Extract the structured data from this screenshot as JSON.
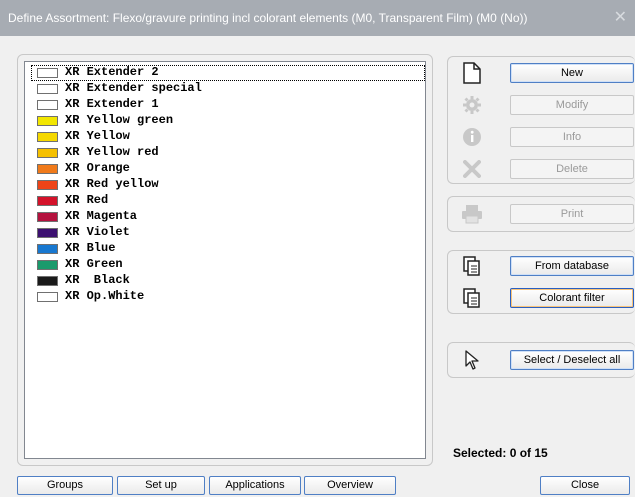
{
  "window": {
    "title": "Define Assortment: Flexo/gravure printing incl colorant elements (M0, Transparent Film) (M0 (No))",
    "close_glyph": "✕"
  },
  "colorant_list": [
    {
      "label": "XR Extender 2",
      "color": "#ffffff"
    },
    {
      "label": "XR Extender special",
      "color": "#ffffff"
    },
    {
      "label": "XR Extender 1",
      "color": "#ffffff"
    },
    {
      "label": "XR Yellow green",
      "color": "#f2e600"
    },
    {
      "label": "XR Yellow",
      "color": "#f5d800"
    },
    {
      "label": "XR Yellow red",
      "color": "#f5c000"
    },
    {
      "label": "XR Orange",
      "color": "#f07a1a"
    },
    {
      "label": "XR Red yellow",
      "color": "#ee4418"
    },
    {
      "label": "XR Red",
      "color": "#d4122a"
    },
    {
      "label": "XR Magenta",
      "color": "#b4123e"
    },
    {
      "label": "XR Violet",
      "color": "#3c1070"
    },
    {
      "label": "XR Blue",
      "color": "#1878d0"
    },
    {
      "label": "XR Green",
      "color": "#1a9a6c"
    },
    {
      "label": "XR  Black",
      "color": "#1a1a1a"
    },
    {
      "label": "XR Op.White",
      "color": "#ffffff"
    }
  ],
  "actions": {
    "new": {
      "label": "New",
      "icon": "new-document-icon",
      "enabled": true
    },
    "modify": {
      "label": "Modify",
      "icon": "gear-icon",
      "enabled": false
    },
    "info": {
      "label": "Info",
      "icon": "info-icon",
      "enabled": false
    },
    "delete": {
      "label": "Delete",
      "icon": "delete-x-icon",
      "enabled": false
    },
    "print": {
      "label": "Print",
      "icon": "printer-icon",
      "enabled": false
    },
    "from_database": {
      "label": "From database",
      "icon": "copy-pages-icon",
      "enabled": true
    },
    "colorant_filter": {
      "label": "Colorant filter",
      "icon": "copy-pages-icon",
      "enabled": true
    },
    "select_all": {
      "label": "Select / Deselect all",
      "icon": "cursor-arrow-icon",
      "enabled": true
    }
  },
  "status": {
    "selected_text": "Selected: 0 of 15"
  },
  "bottom_buttons": {
    "groups": "Groups",
    "setup": "Set up",
    "applications": "Applications",
    "overview": "Overview",
    "close": "Close"
  }
}
